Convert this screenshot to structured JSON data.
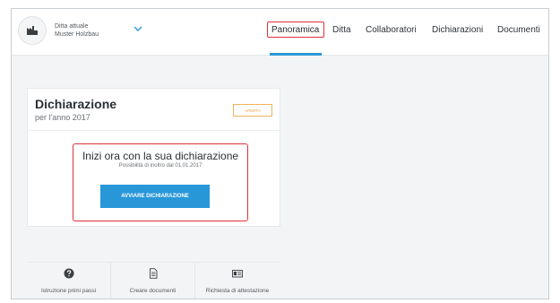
{
  "header": {
    "company_label": "Ditta attuale",
    "company_name": "Muster Holzbau",
    "nav": [
      "Panoramica",
      "Ditta",
      "Collaboratori",
      "Dichiarazioni",
      "Documenti"
    ],
    "active_nav": "Panoramica",
    "accent_color": "#2b9ad7"
  },
  "card": {
    "title": "Dichiarazione",
    "subtitle": "per l'anno 2017",
    "badge": "APERTA",
    "cta_title": "Inizi ora con la sua dichiarazione",
    "cta_subtitle": "Possibilità di inoltro dal 01.01.2017",
    "cta_button": "AVVIARE DICHIARAZIONE",
    "button_color": "#2897d8",
    "highlight_color": "#e0303a"
  },
  "actions": [
    {
      "icon": "help-circle-icon",
      "label": "Istruzione primi passi"
    },
    {
      "icon": "document-icon",
      "label": "Creare documenti"
    },
    {
      "icon": "id-card-icon",
      "label": "Richiesta di attestazione"
    }
  ]
}
